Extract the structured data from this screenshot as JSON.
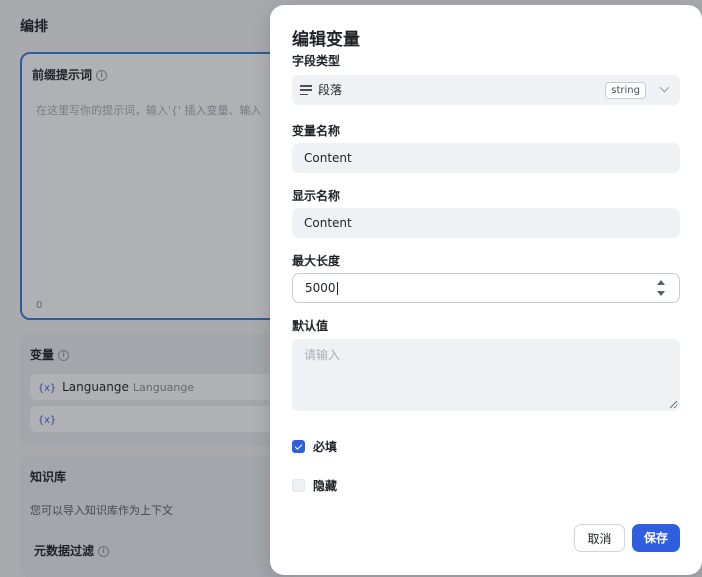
{
  "background": {
    "section_title": "编排",
    "prompt": {
      "title": "前缀提示词",
      "placeholder": "在这里写你的提示词，输入'{' 插入变量、输入",
      "char_count": "0"
    },
    "variables": {
      "title": "变量",
      "items": [
        {
          "brace": "{x}",
          "name": "Languange",
          "label": "Languange"
        },
        {
          "brace": "{x}",
          "name": "",
          "label": ""
        }
      ]
    },
    "knowledge": {
      "title": "知识库",
      "description": "您可以导入知识库作为上下文",
      "metadata_filter": "元数据过滤"
    }
  },
  "modal": {
    "title": "编辑变量",
    "field_type": {
      "label": "字段类型",
      "value": "段落",
      "badge": "string",
      "icon": "paragraph-icon"
    },
    "variable_name": {
      "label": "变量名称",
      "value": "Content"
    },
    "display_name": {
      "label": "显示名称",
      "value": "Content"
    },
    "max_length": {
      "label": "最大长度",
      "value": "5000"
    },
    "default_value": {
      "label": "默认值",
      "placeholder": "请输入"
    },
    "required": {
      "label": "必填",
      "checked": true
    },
    "hidden": {
      "label": "隐藏",
      "checked": false
    },
    "cancel_label": "取消",
    "save_label": "保存"
  },
  "colors": {
    "accent": "#2f5fde",
    "focus_border": "#3b7bd6"
  }
}
